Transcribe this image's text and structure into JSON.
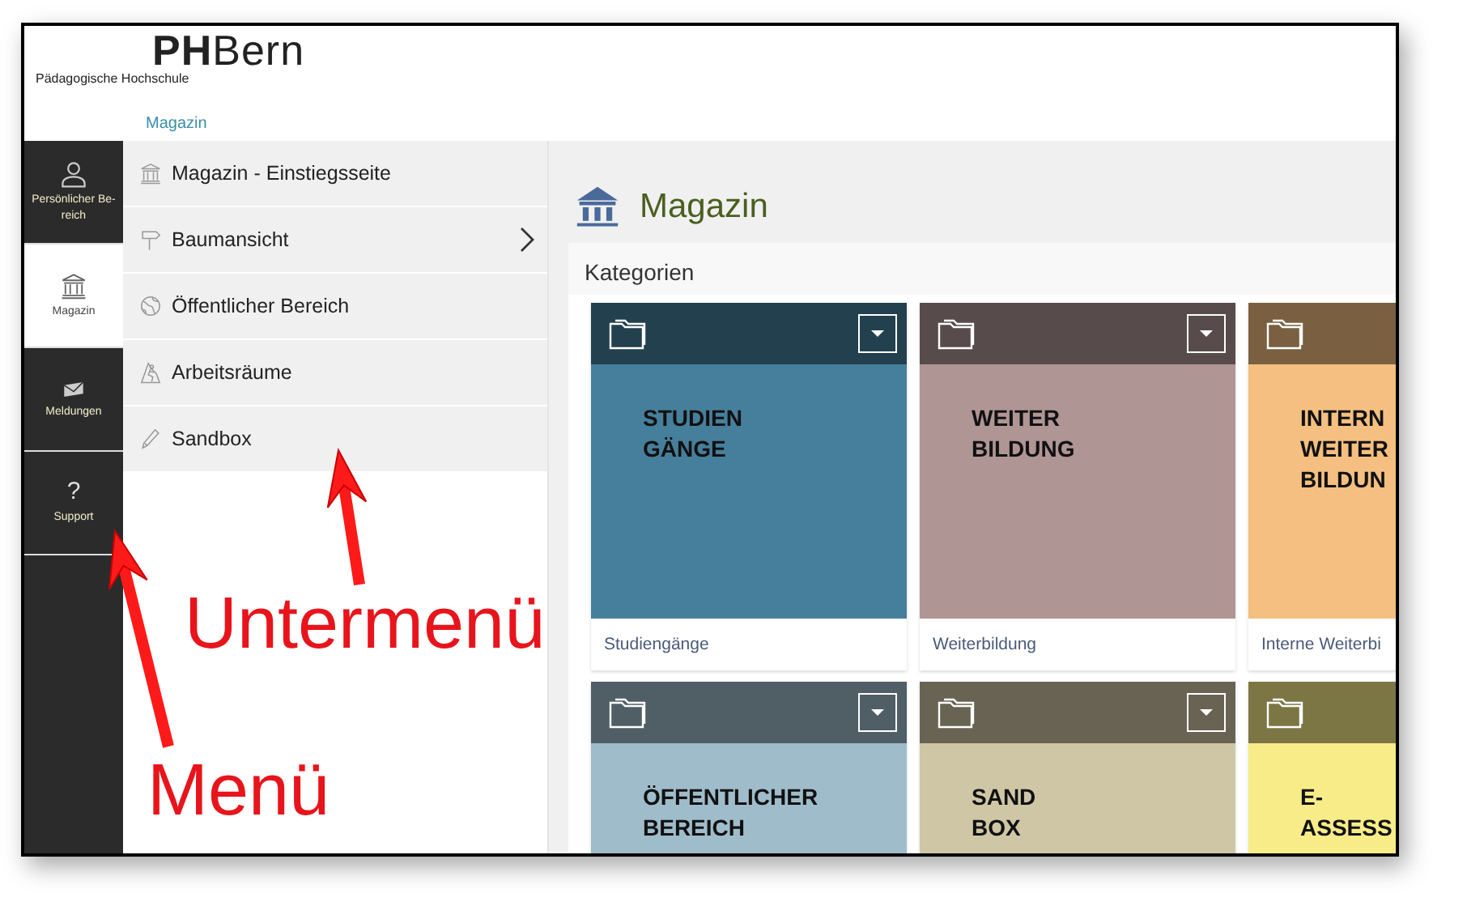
{
  "header": {
    "logo": "**PH**Bern",
    "subtitle": "Pädagogische Hochschule",
    "nav": [
      {
        "label": "Magazin",
        "selected": true
      }
    ]
  },
  "menu": [
    {
      "kind": "person",
      "label": "Persönlicher Be-reich",
      "selected": false
    },
    {
      "kind": "bank",
      "label": "Magazin",
      "selected": true
    },
    {
      "kind": "envelope",
      "label": "Meldungen",
      "selected": false
    },
    {
      "kind": "glyph",
      "glyph": "?",
      "label": "Support",
      "selected": false
    }
  ],
  "submenu": [
    {
      "kind": "bank",
      "label": "Magazin - Einstiegsseite",
      "has_children": false
    },
    {
      "kind": "signpost",
      "label": "Baumansicht",
      "has_children": true
    },
    {
      "kind": "globe",
      "label": "Öffentlicher Bereich",
      "has_children": false
    },
    {
      "kind": "climber",
      "label": "Arbeitsräume",
      "has_children": false
    },
    {
      "kind": "pencil",
      "label": "Sandbox",
      "has_children": false
    }
  ],
  "content": {
    "title": "Magazin",
    "section": "Kategorien",
    "cards": [
      {
        "color": "#467f9c",
        "lines": [
          "STUDIEN",
          "GÄNGE"
        ],
        "caption": "Studiengänge",
        "dropdown": true
      },
      {
        "color": "#b09595",
        "lines": [
          "WEITER",
          "BILDUNG"
        ],
        "caption": "Weiterbildung",
        "dropdown": true
      },
      {
        "color": "#f4bf80",
        "lines": [
          "INTERN",
          "WEITER",
          "BILDUN"
        ],
        "caption": "Interne Weiterbi",
        "dropdown": false
      },
      {
        "color": "#9fbccb",
        "lines": [
          "ÖFFENTLICHER",
          "BEREICH"
        ],
        "dropdown": true
      },
      {
        "color": "#cfc6a6",
        "lines": [
          "SAND",
          "BOX"
        ],
        "dropdown": true
      },
      {
        "color": "#f7ec88",
        "lines": [
          "E-",
          "ASSESS"
        ],
        "dropdown": false
      }
    ]
  },
  "annotations": [
    {
      "text": "Untermenü"
    },
    {
      "text": "Menü"
    }
  ]
}
